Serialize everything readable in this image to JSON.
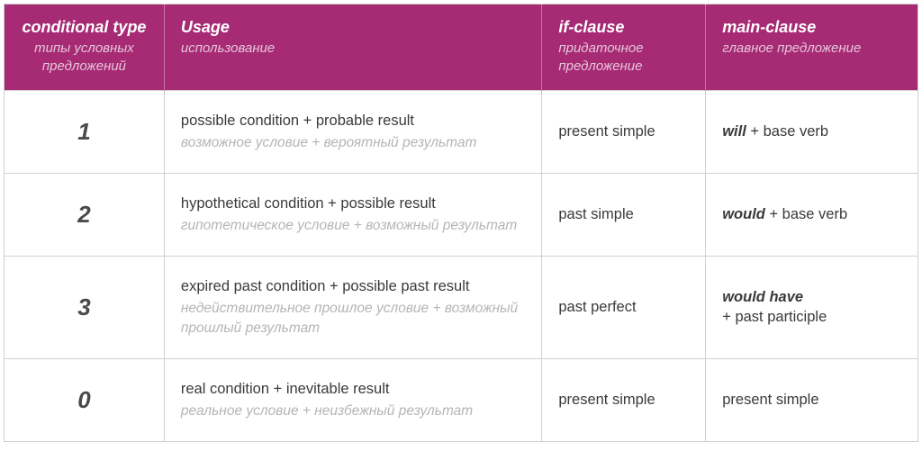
{
  "headers": {
    "type": {
      "en": "conditional type",
      "ru": "типы условных предложений"
    },
    "usage": {
      "en": "Usage",
      "ru": "использование"
    },
    "if": {
      "en": "if-clause",
      "ru": "придаточное предложение"
    },
    "main": {
      "en": "main-clause",
      "ru": "главное предложение"
    }
  },
  "rows": [
    {
      "type": "1",
      "usage_en": "possible condition + probable result",
      "usage_ru": "возможное условие + вероятный результат",
      "if_en": "present simple",
      "main_bold": "will",
      "main_rest": " + base verb"
    },
    {
      "type": "2",
      "usage_en": "hypothetical condition + possible result",
      "usage_ru": "гипотетическое условие + возможный результат",
      "if_en": "past simple",
      "main_bold": "would",
      "main_rest": " + base verb"
    },
    {
      "type": "3",
      "usage_en": "expired past condition + possible past result",
      "usage_ru": "недействительное прошлое условие + возможный прошлый результат",
      "if_en": "past perfect",
      "main_bold": "would have",
      "main_rest": " + past participle"
    },
    {
      "type": "0",
      "usage_en": "real condition + inevitable result",
      "usage_ru": "реальное условие + неизбежный результат",
      "if_en": "present simple",
      "main_bold": "",
      "main_rest": "present simple"
    }
  ]
}
